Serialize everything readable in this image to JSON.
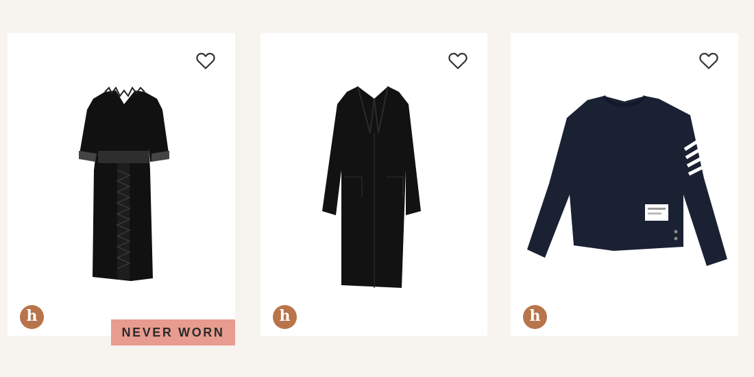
{
  "products": [
    {
      "name": "black lace trim dress",
      "brand_badge": "h",
      "condition_tag": "NEVER WORN",
      "wishlist_icon": "heart-outline-icon"
    },
    {
      "name": "black long coat",
      "brand_badge": "h",
      "wishlist_icon": "heart-outline-icon"
    },
    {
      "name": "navy striped-sleeve sweatshirt",
      "brand_badge": "h",
      "wishlist_icon": "heart-outline-icon"
    }
  ],
  "colors": {
    "page_background": "#f7f3ef",
    "card_background": "#ffffff",
    "badge_color": "#b8744a",
    "tag_color": "#e89c8f"
  }
}
